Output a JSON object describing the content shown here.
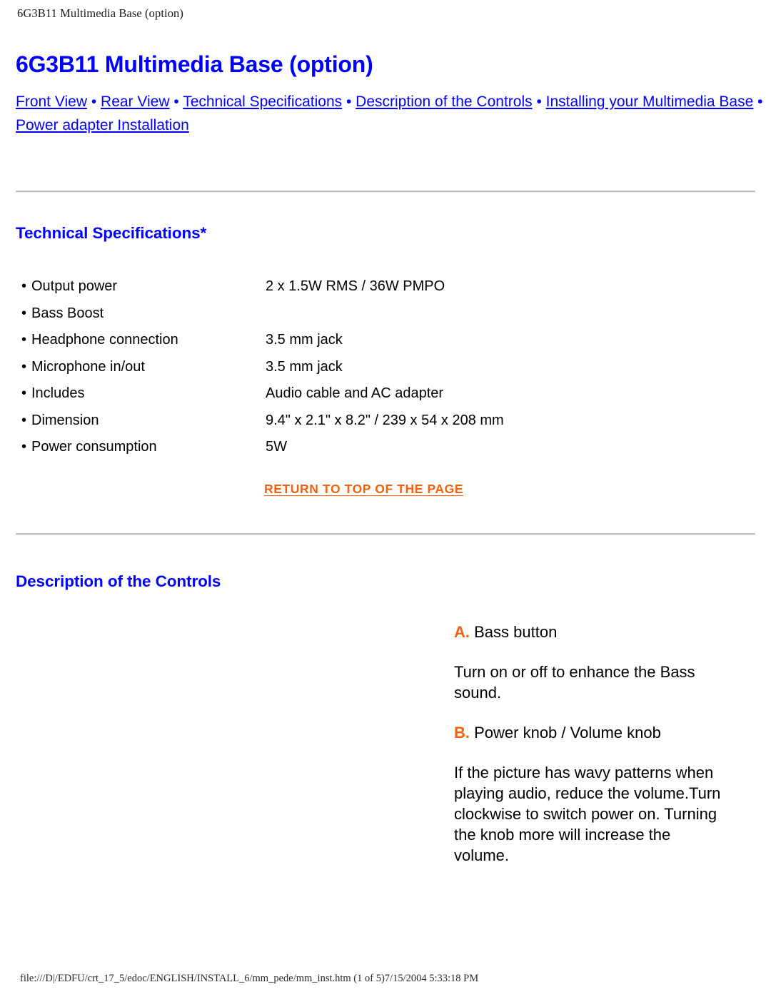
{
  "running_head": "6G3B11 Multimedia Base (option)",
  "title": "6G3B11 Multimedia Base (option)",
  "nav": {
    "separator": "•",
    "links": [
      "Front View",
      "Rear View",
      "Technical Specifications",
      "Description of the Controls",
      "Installing your Multimedia Base",
      "Power adapter Installation"
    ]
  },
  "tech_specs": {
    "heading": "Technical Specifications*",
    "bullet": "•",
    "rows": [
      {
        "label": "Output power",
        "value": "2 x 1.5W RMS / 36W PMPO"
      },
      {
        "label": "Bass Boost",
        "value": ""
      },
      {
        "label": "Headphone connection",
        "value": "3.5 mm jack"
      },
      {
        "label": "Microphone in/out",
        "value": "3.5 mm jack"
      },
      {
        "label": "Includes",
        "value": "Audio cable and AC adapter"
      },
      {
        "label": "Dimension",
        "value": "9.4\" x 2.1\" x 8.2\" / 239 x 54 x 208 mm"
      },
      {
        "label": "Power consumption",
        "value": "5W"
      }
    ]
  },
  "return_to_top": "RETURN TO TOP OF THE PAGE",
  "controls": {
    "heading": "Description of the Controls",
    "items": [
      {
        "marker": "A.",
        "text": " Bass button"
      },
      {
        "marker": "",
        "text": "Turn on or off to enhance the Bass sound."
      },
      {
        "marker": "B.",
        "text": " Power knob / Volume knob"
      },
      {
        "marker": "",
        "text": "If the picture has wavy patterns when playing audio, reduce the volume.Turn clockwise to switch power on. Turning the knob more will increase the volume."
      }
    ]
  },
  "footer": "file:///D|/EDFU/crt_17_5/edoc/ENGLISH/INSTALL_6/mm_pede/mm_inst.htm (1 of 5)7/15/2004 5:33:18 PM",
  "colors": {
    "link_blue": "#0000ff",
    "heading_blue": "#0000ff",
    "accent_orange": "#f4610d",
    "text_black": "#000000",
    "rule_gray": "#c0c0c0"
  }
}
